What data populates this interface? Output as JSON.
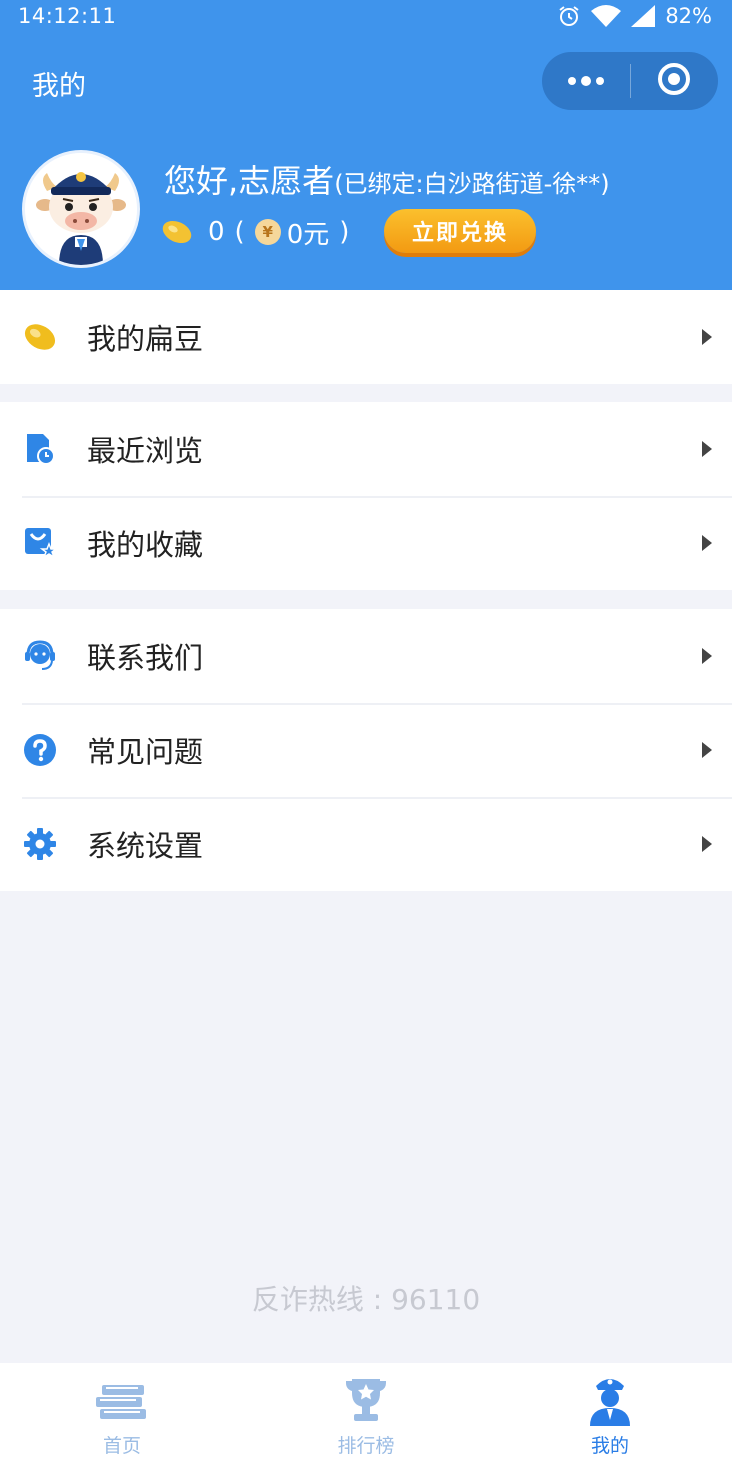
{
  "status_bar": {
    "time": "14:12:11",
    "battery": "82%",
    "icons": [
      "alarm-icon",
      "wifi-icon",
      "signal-icon"
    ]
  },
  "header": {
    "title": "我的",
    "capsule": [
      "more-icon",
      "close-miniprogram-icon"
    ]
  },
  "profile": {
    "greeting": "您好,志愿者",
    "bound_info": "(已绑定:白沙路街道-徐**)",
    "beans": "0",
    "paren_open": "(",
    "yen_symbol": "¥",
    "money": "0元",
    "paren_close": ")",
    "exchange_label": "立即兑换"
  },
  "menu": {
    "group1": [
      {
        "label": "我的扁豆",
        "icon": "bean-icon"
      }
    ],
    "group2": [
      {
        "label": "最近浏览",
        "icon": "recent-browse-icon"
      },
      {
        "label": "我的收藏",
        "icon": "favorites-icon"
      }
    ],
    "group3": [
      {
        "label": "联系我们",
        "icon": "headset-icon"
      },
      {
        "label": "常见问题",
        "icon": "question-icon"
      },
      {
        "label": "系统设置",
        "icon": "gear-icon"
      }
    ]
  },
  "footer": {
    "hotline": "反诈热线 : 96110"
  },
  "tabs": [
    {
      "label": "首页",
      "icon": "books-icon",
      "active": false
    },
    {
      "label": "排行榜",
      "icon": "trophy-icon",
      "active": false
    },
    {
      "label": "我的",
      "icon": "police-icon",
      "active": true
    }
  ],
  "colors": {
    "primary": "#3f94ec",
    "accent": "#f39a12",
    "page_bg": "#f2f3f9",
    "tab_active": "#2a7de6",
    "tab_inactive": "#9bbce4"
  }
}
